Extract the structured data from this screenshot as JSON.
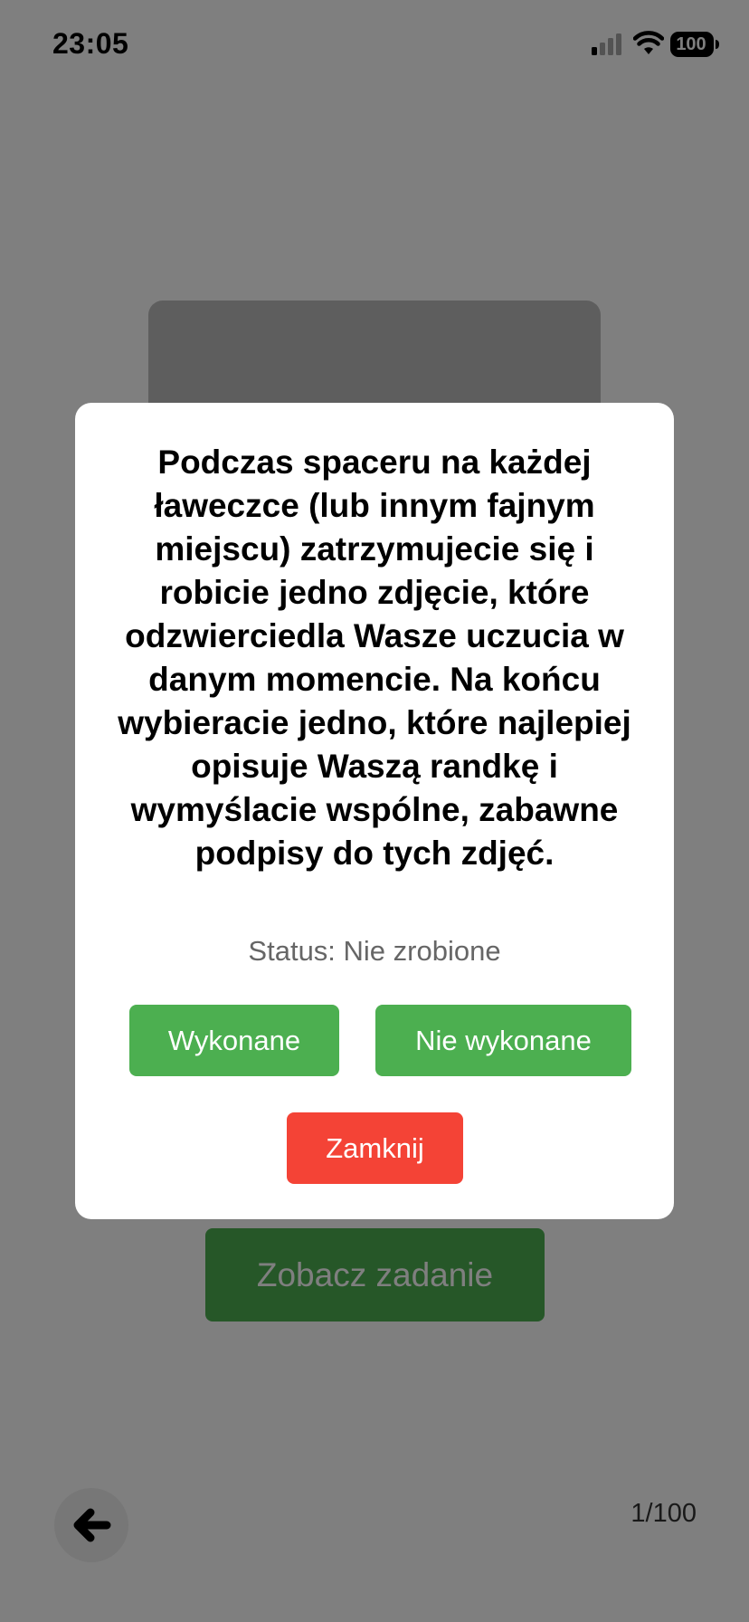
{
  "status_bar": {
    "time": "23:05",
    "battery": "100"
  },
  "background": {
    "see_task_label": "Zobacz zadanie",
    "page_counter": "1/100"
  },
  "modal": {
    "task_text": "Podczas spaceru na każdej ławeczce (lub innym fajnym miejscu) zatrzymujecie się i robicie jedno zdjęcie, które odzwierciedla Wasze uczucia w danym momencie. Na końcu wybieracie jedno, które najlepiej opisuje Waszą randkę i wymyślacie wspólne, zabawne podpisy do tych zdjęć.",
    "status": "Status: Nie zrobione",
    "done_label": "Wykonane",
    "not_done_label": "Nie wykonane",
    "close_label": "Zamknij"
  },
  "colors": {
    "green": "#4caf50",
    "red": "#f44336",
    "overlay": "rgba(0,0,0,0.5)"
  },
  "icons": {
    "back": "arrow-left-icon",
    "signal": "cellular-signal-icon",
    "wifi": "wifi-icon",
    "battery": "battery-icon"
  }
}
